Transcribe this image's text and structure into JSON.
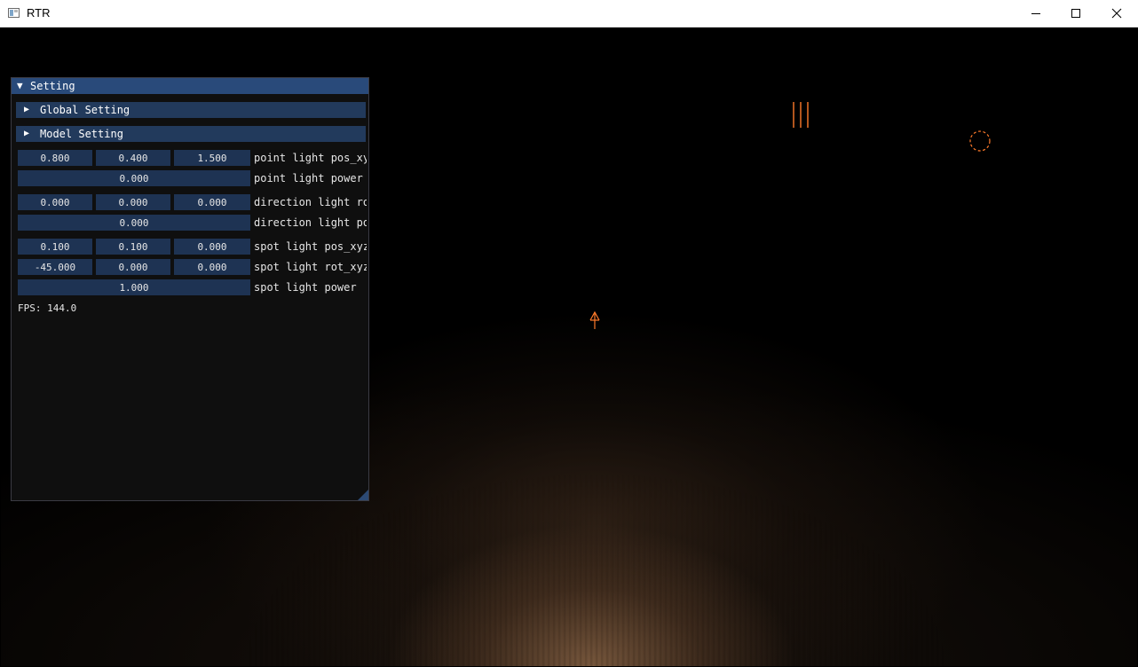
{
  "window": {
    "title": "RTR"
  },
  "panel": {
    "title": "Setting",
    "sections": [
      {
        "label": "Global Setting"
      },
      {
        "label": "Model Setting"
      }
    ],
    "rows": [
      {
        "values": [
          "0.800",
          "0.400",
          "1.500"
        ],
        "label": "point light pos_xy"
      },
      {
        "values": [
          "0.000"
        ],
        "label": "point light power"
      },
      {
        "values": [
          "0.000",
          "0.000",
          "0.000"
        ],
        "label": "direction light ro"
      },
      {
        "values": [
          "0.000"
        ],
        "label": "direction light po"
      },
      {
        "values": [
          "0.100",
          "0.100",
          "0.000"
        ],
        "label": "spot light pos_xyz"
      },
      {
        "values": [
          "-45.000",
          "0.000",
          "0.000"
        ],
        "label": "spot light rot_xyz"
      },
      {
        "values": [
          "1.000"
        ],
        "label": "spot light power"
      }
    ],
    "fps": "FPS: 144.0"
  },
  "gizmo_color": "#ff7a2a"
}
